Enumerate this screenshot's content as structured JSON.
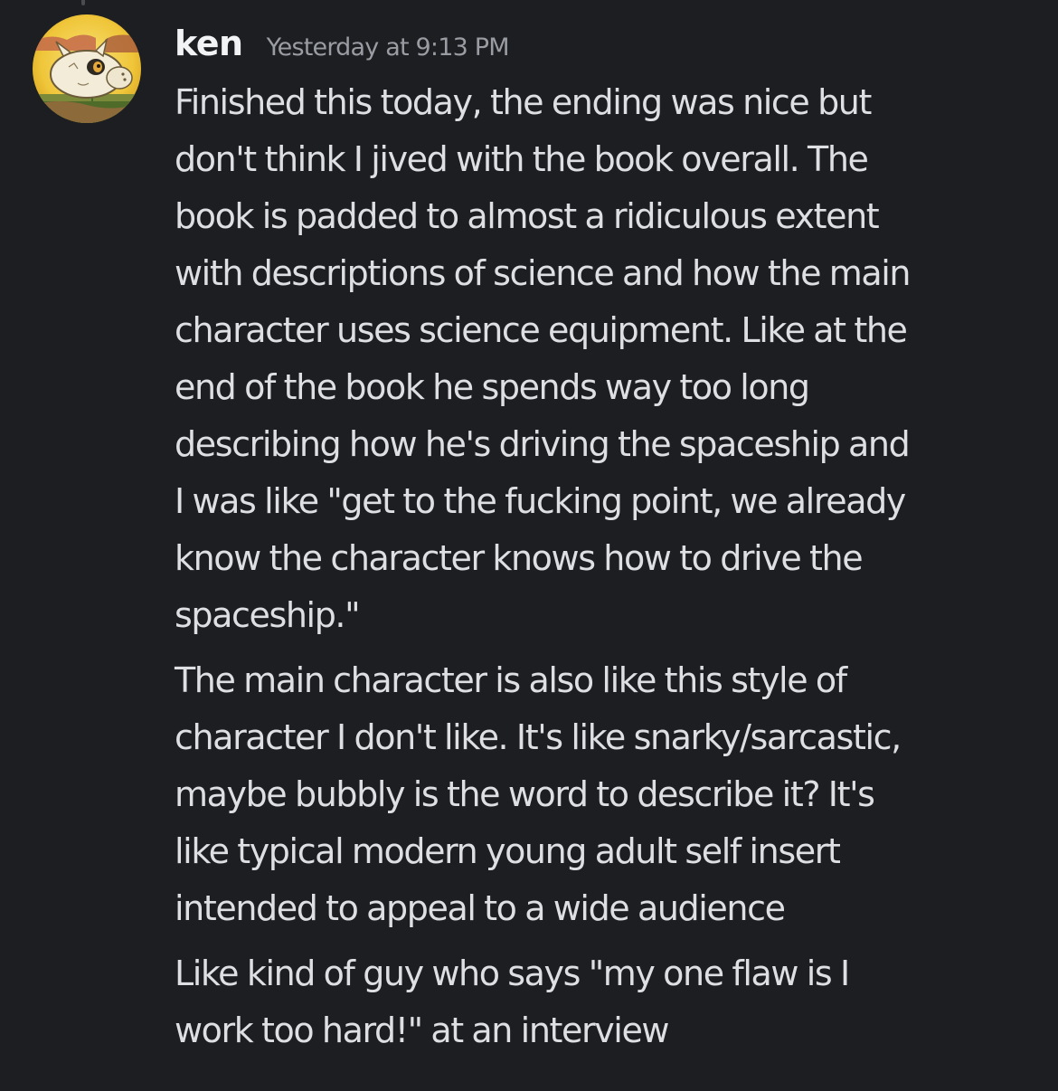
{
  "message": {
    "username": "ken",
    "timestamp": "Yesterday at 9:13 PM",
    "paragraphs": [
      {
        "lines": [
          "Finished this today, the ending was nice but",
          "don't think I jived with the book overall. The",
          "book is padded to almost a ridiculous extent",
          "with descriptions of science and how the main",
          "character uses science equipment. Like at the",
          "end of the book he spends way too long",
          "describing how he's driving the spaceship and",
          "I was like \"get to the fucking point, we already",
          "know the character knows how to drive the",
          "spaceship.\""
        ]
      },
      {
        "lines": [
          "The main character is also like this style of",
          "character I don't like. It's like snarky/sarcastic,",
          "maybe bubbly is the word to describe it? It's",
          "like typical modern young adult self insert",
          "intended to appeal to a wide audience"
        ]
      },
      {
        "lines": [
          "Like kind of guy who says \"my one flaw is I",
          "work too hard!\" at an interview"
        ]
      }
    ]
  },
  "avatar": {
    "icon": "cubone-pokemon-avatar-icon"
  },
  "colors": {
    "background": "#1d1e22",
    "username": "#f2f3f5",
    "timestamp": "#9a9ca3",
    "message_text": "#dedfe3"
  }
}
